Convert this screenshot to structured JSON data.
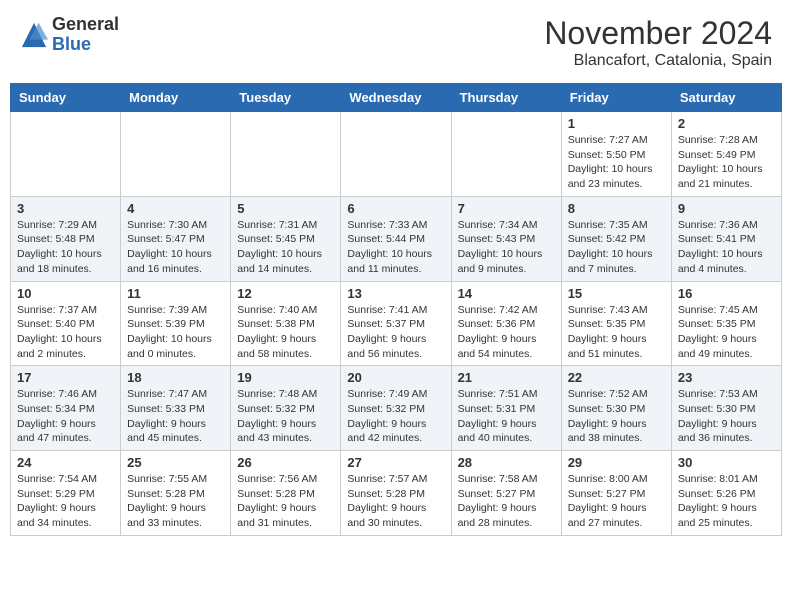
{
  "logo": {
    "general": "General",
    "blue": "Blue"
  },
  "title": "November 2024",
  "subtitle": "Blancafort, Catalonia, Spain",
  "days_of_week": [
    "Sunday",
    "Monday",
    "Tuesday",
    "Wednesday",
    "Thursday",
    "Friday",
    "Saturday"
  ],
  "weeks": [
    [
      {
        "day": "",
        "info": ""
      },
      {
        "day": "",
        "info": ""
      },
      {
        "day": "",
        "info": ""
      },
      {
        "day": "",
        "info": ""
      },
      {
        "day": "",
        "info": ""
      },
      {
        "day": "1",
        "info": "Sunrise: 7:27 AM\nSunset: 5:50 PM\nDaylight: 10 hours and 23 minutes."
      },
      {
        "day": "2",
        "info": "Sunrise: 7:28 AM\nSunset: 5:49 PM\nDaylight: 10 hours and 21 minutes."
      }
    ],
    [
      {
        "day": "3",
        "info": "Sunrise: 7:29 AM\nSunset: 5:48 PM\nDaylight: 10 hours and 18 minutes."
      },
      {
        "day": "4",
        "info": "Sunrise: 7:30 AM\nSunset: 5:47 PM\nDaylight: 10 hours and 16 minutes."
      },
      {
        "day": "5",
        "info": "Sunrise: 7:31 AM\nSunset: 5:45 PM\nDaylight: 10 hours and 14 minutes."
      },
      {
        "day": "6",
        "info": "Sunrise: 7:33 AM\nSunset: 5:44 PM\nDaylight: 10 hours and 11 minutes."
      },
      {
        "day": "7",
        "info": "Sunrise: 7:34 AM\nSunset: 5:43 PM\nDaylight: 10 hours and 9 minutes."
      },
      {
        "day": "8",
        "info": "Sunrise: 7:35 AM\nSunset: 5:42 PM\nDaylight: 10 hours and 7 minutes."
      },
      {
        "day": "9",
        "info": "Sunrise: 7:36 AM\nSunset: 5:41 PM\nDaylight: 10 hours and 4 minutes."
      }
    ],
    [
      {
        "day": "10",
        "info": "Sunrise: 7:37 AM\nSunset: 5:40 PM\nDaylight: 10 hours and 2 minutes."
      },
      {
        "day": "11",
        "info": "Sunrise: 7:39 AM\nSunset: 5:39 PM\nDaylight: 10 hours and 0 minutes."
      },
      {
        "day": "12",
        "info": "Sunrise: 7:40 AM\nSunset: 5:38 PM\nDaylight: 9 hours and 58 minutes."
      },
      {
        "day": "13",
        "info": "Sunrise: 7:41 AM\nSunset: 5:37 PM\nDaylight: 9 hours and 56 minutes."
      },
      {
        "day": "14",
        "info": "Sunrise: 7:42 AM\nSunset: 5:36 PM\nDaylight: 9 hours and 54 minutes."
      },
      {
        "day": "15",
        "info": "Sunrise: 7:43 AM\nSunset: 5:35 PM\nDaylight: 9 hours and 51 minutes."
      },
      {
        "day": "16",
        "info": "Sunrise: 7:45 AM\nSunset: 5:35 PM\nDaylight: 9 hours and 49 minutes."
      }
    ],
    [
      {
        "day": "17",
        "info": "Sunrise: 7:46 AM\nSunset: 5:34 PM\nDaylight: 9 hours and 47 minutes."
      },
      {
        "day": "18",
        "info": "Sunrise: 7:47 AM\nSunset: 5:33 PM\nDaylight: 9 hours and 45 minutes."
      },
      {
        "day": "19",
        "info": "Sunrise: 7:48 AM\nSunset: 5:32 PM\nDaylight: 9 hours and 43 minutes."
      },
      {
        "day": "20",
        "info": "Sunrise: 7:49 AM\nSunset: 5:32 PM\nDaylight: 9 hours and 42 minutes."
      },
      {
        "day": "21",
        "info": "Sunrise: 7:51 AM\nSunset: 5:31 PM\nDaylight: 9 hours and 40 minutes."
      },
      {
        "day": "22",
        "info": "Sunrise: 7:52 AM\nSunset: 5:30 PM\nDaylight: 9 hours and 38 minutes."
      },
      {
        "day": "23",
        "info": "Sunrise: 7:53 AM\nSunset: 5:30 PM\nDaylight: 9 hours and 36 minutes."
      }
    ],
    [
      {
        "day": "24",
        "info": "Sunrise: 7:54 AM\nSunset: 5:29 PM\nDaylight: 9 hours and 34 minutes."
      },
      {
        "day": "25",
        "info": "Sunrise: 7:55 AM\nSunset: 5:28 PM\nDaylight: 9 hours and 33 minutes."
      },
      {
        "day": "26",
        "info": "Sunrise: 7:56 AM\nSunset: 5:28 PM\nDaylight: 9 hours and 31 minutes."
      },
      {
        "day": "27",
        "info": "Sunrise: 7:57 AM\nSunset: 5:28 PM\nDaylight: 9 hours and 30 minutes."
      },
      {
        "day": "28",
        "info": "Sunrise: 7:58 AM\nSunset: 5:27 PM\nDaylight: 9 hours and 28 minutes."
      },
      {
        "day": "29",
        "info": "Sunrise: 8:00 AM\nSunset: 5:27 PM\nDaylight: 9 hours and 27 minutes."
      },
      {
        "day": "30",
        "info": "Sunrise: 8:01 AM\nSunset: 5:26 PM\nDaylight: 9 hours and 25 minutes."
      }
    ]
  ]
}
